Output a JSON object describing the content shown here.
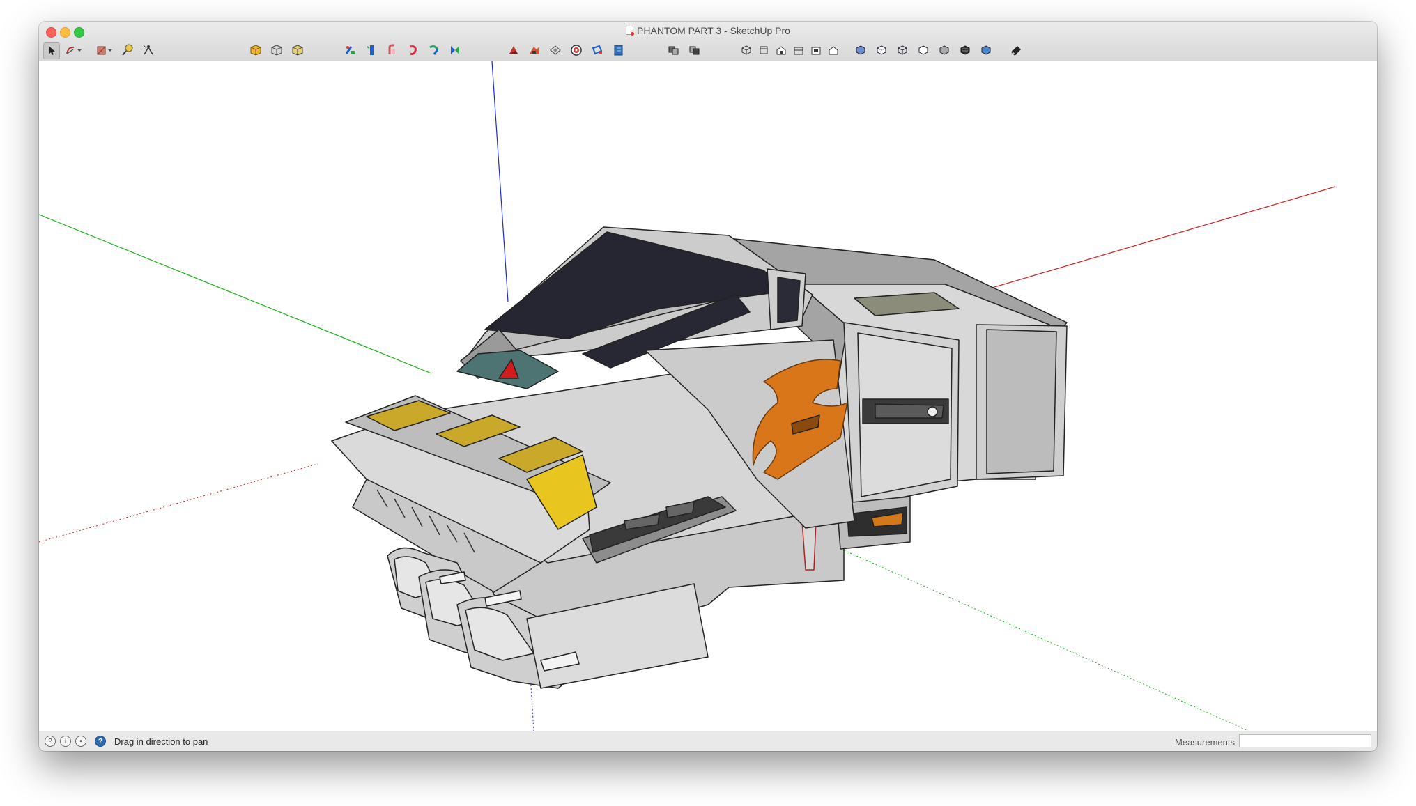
{
  "window": {
    "title": "PHANTOM PART 3 - SketchUp Pro"
  },
  "toolbar": {
    "groups": [
      [
        "select-tool",
        "line-tool",
        "eraser-tool",
        "tape-measure-tool",
        "text-tool"
      ],
      [
        "components-box-icon",
        "component-options-icon",
        "component-attributes-icon"
      ],
      [
        "move-tool",
        "push-pull-tool",
        "rotate-tool",
        "follow-me-tool",
        "scale-tool",
        "offset-tool"
      ],
      [
        "sandbox-from-contours-icon",
        "sandbox-smoove-icon",
        "section-plane-icon",
        "warehouse-icon",
        "extension-icon",
        "layout-send-icon"
      ],
      [
        "solid-tools-icon",
        "intersect-icon"
      ],
      [
        "iso-view-icon",
        "top-view-icon",
        "front-view-icon",
        "right-view-icon",
        "back-view-icon",
        "left-view-icon"
      ],
      [
        "xray-style-icon",
        "back-edges-style-icon",
        "wireframe-style-icon",
        "hidden-line-style-icon",
        "shaded-style-icon",
        "shaded-textures-style-icon",
        "monochrome-style-icon"
      ],
      [
        "styles-icon"
      ]
    ]
  },
  "status": {
    "message": "Drag in direction to pan",
    "measurements_label": "Measurements",
    "measurements_value": ""
  }
}
